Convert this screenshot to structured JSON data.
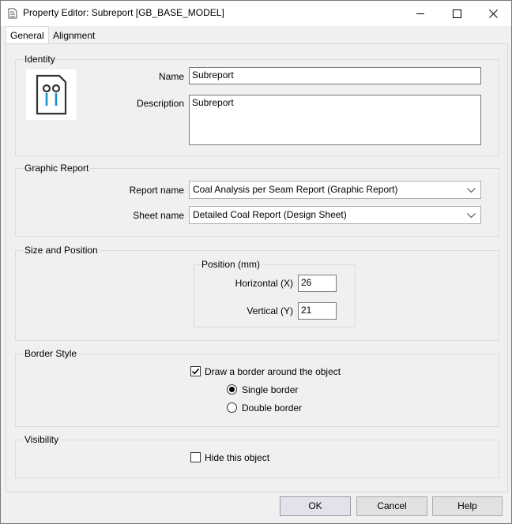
{
  "window": {
    "title": "Property Editor: Subreport [GB_BASE_MODEL]",
    "minimize_icon": "minimize-icon",
    "maximize_icon": "maximize-icon",
    "close_icon": "close-icon"
  },
  "tabs": [
    {
      "label": "General",
      "active": true
    },
    {
      "label": "Alignment",
      "active": false
    }
  ],
  "identity": {
    "legend": "Identity",
    "icon": "subreport-document-icon",
    "name_label": "Name",
    "name_value": "Subreport",
    "description_label": "Description",
    "description_value": "Subreport"
  },
  "graphic_report": {
    "legend": "Graphic Report",
    "report_name_label": "Report name",
    "report_name_value": "Coal Analysis per Seam Report (Graphic Report)",
    "sheet_name_label": "Sheet name",
    "sheet_name_value": "Detailed Coal Report (Design Sheet)"
  },
  "size_position": {
    "legend": "Size and Position",
    "position_legend": "Position (mm)",
    "horizontal_label": "Horizontal (X)",
    "horizontal_value": "26",
    "vertical_label": "Vertical (Y)",
    "vertical_value": "21"
  },
  "border_style": {
    "legend": "Border Style",
    "draw_border_label": "Draw a border around the object",
    "draw_border_checked": true,
    "single_label": "Single border",
    "double_label": "Double border",
    "selected": "single"
  },
  "visibility": {
    "legend": "Visibility",
    "hide_label": "Hide this object",
    "hide_checked": false
  },
  "buttons": {
    "ok": "OK",
    "cancel": "Cancel",
    "help": "Help"
  },
  "colors": {
    "icon_accent": "#1e8fc6",
    "check_mark": "#000000"
  }
}
